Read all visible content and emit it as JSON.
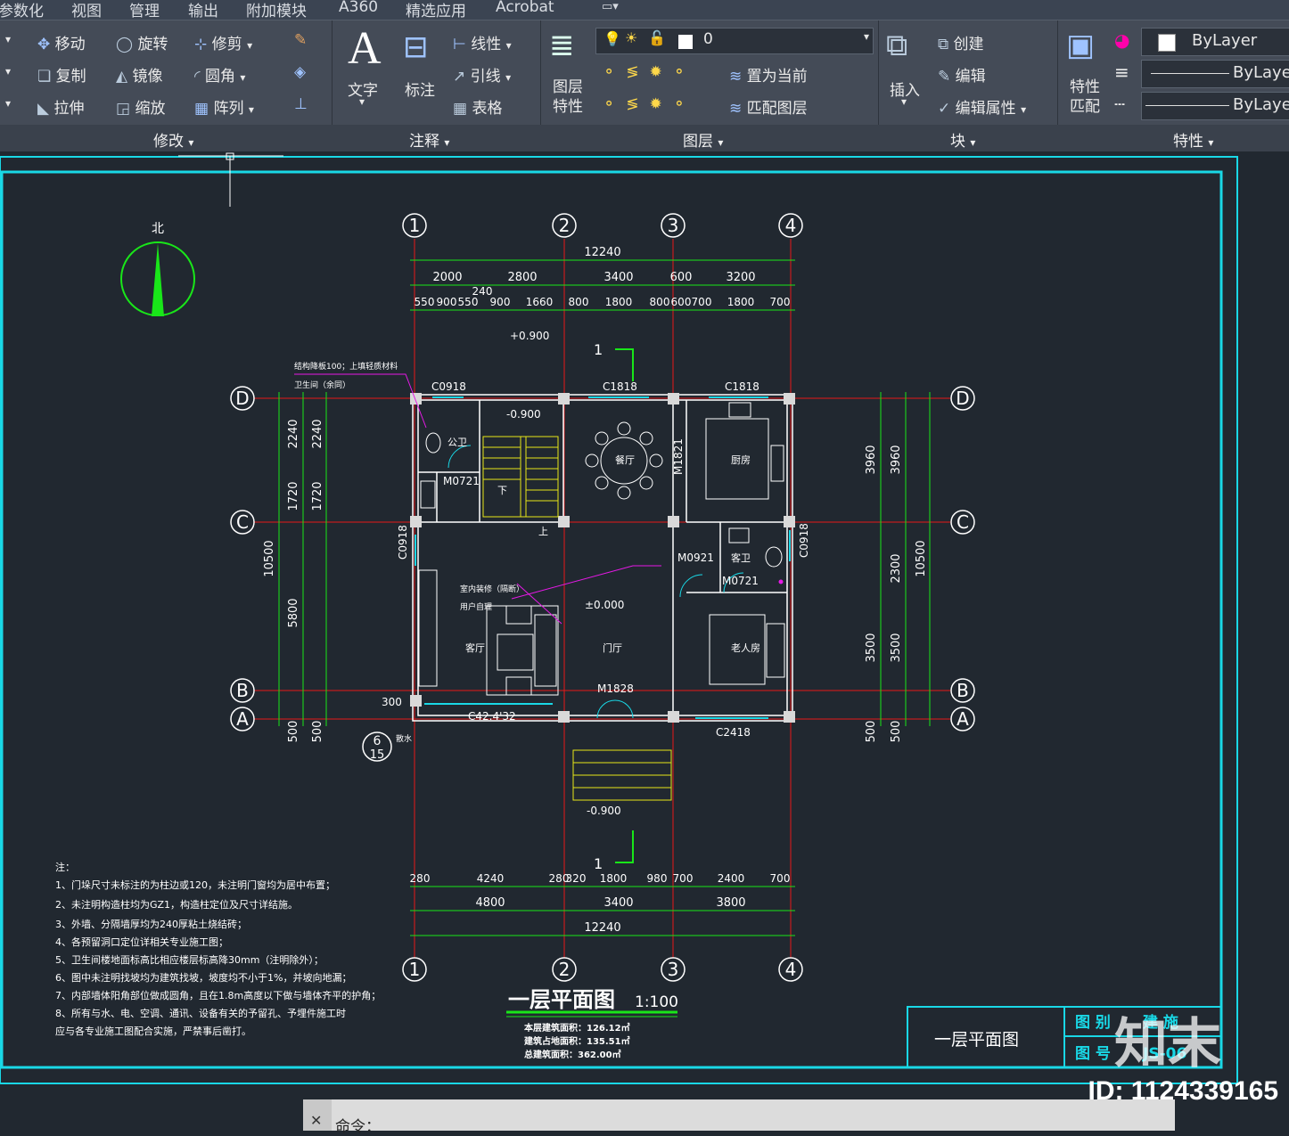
{
  "menu": [
    "参数化",
    "视图",
    "管理",
    "输出",
    "附加模块",
    "A360",
    "精选应用",
    "Acrobat"
  ],
  "modify": {
    "move": "移动",
    "rotate": "旋转",
    "trim": "修剪",
    "copy": "复制",
    "mirror": "镜像",
    "fillet": "圆角",
    "stretch": "拉伸",
    "scale": "缩放",
    "array": "阵列",
    "group": "修改"
  },
  "annot": {
    "text": "文字",
    "dim": "标注",
    "linear": "线性",
    "leader": "引线",
    "table": "表格",
    "group": "注释"
  },
  "layers": {
    "props": [
      "图层",
      "特性"
    ],
    "current": "0",
    "set_current": "置为当前",
    "match": "匹配图层",
    "group": "图层"
  },
  "block": {
    "insert": "插入",
    "create": "创建",
    "edit": "编辑",
    "edit_attr": "编辑属性",
    "group": "块"
  },
  "props": {
    "match": [
      "特性",
      "匹配"
    ],
    "bylayer1": "ByLayer",
    "bylayer2": "ByLayer",
    "bylayer3": "ByLayer",
    "group": "特性"
  },
  "drawing": {
    "north": "北",
    "grid_top": [
      "1",
      "2",
      "3",
      "4"
    ],
    "grid_side": [
      "D",
      "C",
      "B",
      "A"
    ],
    "dims_top_total": "12240",
    "dims_top_mid": [
      "2000",
      "2800",
      "3400",
      "600",
      "3200"
    ],
    "dims_top_fine": [
      "550",
      "900",
      "550",
      "240",
      "900",
      "1660",
      "800",
      "1800",
      "800",
      "600",
      "700",
      "1800",
      "700"
    ],
    "dims_bottom_fine": [
      "280",
      "4240",
      "280",
      "320",
      "1800",
      "980",
      "700",
      "2400",
      "700"
    ],
    "dims_bottom_mid": [
      "4800",
      "3400",
      "3800"
    ],
    "dims_bottom_total": "12240",
    "dims_left": [
      "2240",
      "1720",
      "5800",
      "10500",
      "500"
    ],
    "dims_right": [
      "3960",
      "2300",
      "3500",
      "10500",
      "500"
    ],
    "rooms": [
      "餐厅",
      "厨房",
      "客厅",
      "门厅",
      "老人房",
      "公卫",
      "客卫"
    ],
    "labels": [
      "C0918",
      "C1818",
      "C1818",
      "M1821",
      "C0918",
      "C0918",
      "M0721",
      "M0921",
      "M0721",
      "M1828",
      "C2418",
      "C42.4'32",
      "-0.900",
      "+0.900",
      "±0.000",
      "-0.900",
      "上",
      "下",
      "室内装修（隔断）",
      "用户自理",
      "结构降板100；上填轻质材料",
      "卫生间（余同）",
      "散水",
      "300"
    ],
    "section_marks": [
      "1",
      "1"
    ],
    "detail": [
      "6",
      "15"
    ],
    "notes_title": "注：",
    "notes": [
      "1、门垛尺寸未标注的为柱边或120，未注明门窗均为居中布置；",
      "2、未注明构造柱均为GZ1，构造柱定位及尺寸详结施。",
      "3、外墙、分隔墙厚均为240厚粘土烧结砖；",
      "4、各预留洞口定位详相关专业施工图；",
      "5、卫生间楼地面标高比相应楼层标高降30mm（注明除外）；",
      "6、图中未注明找坡均为建筑找坡，坡度均不小于1%，并坡向地漏；",
      "7、内部墙体阳角部位做成圆角，且在1.8m高度以下做与墙体齐平的护角；",
      "8、所有与水、电、空调、通讯、设备有关的予留孔、予埋件施工时",
      "   应与各专业施工图配合实施，严禁事后凿打。"
    ],
    "title": "一层平面图",
    "scale": "1:100",
    "areas": [
      "本层建筑面积：126.12㎡",
      "建筑占地面积：135.51㎡",
      "总建筑面积：362.00㎡"
    ],
    "titleblock_name": "一层平面图",
    "tb_labels": [
      "图 别",
      "建 施",
      "图 号",
      "JS-06"
    ]
  },
  "command_prompt": "命令：",
  "watermark": "知末",
  "id_text": "ID: 1124339165",
  "colors": {
    "green": "#19e619",
    "cyan": "#19d8e6",
    "white": "#ffffff",
    "red": "#e61919",
    "yellow": "#e6e619",
    "magenta": "#e619e6",
    "bg": "#212830"
  }
}
